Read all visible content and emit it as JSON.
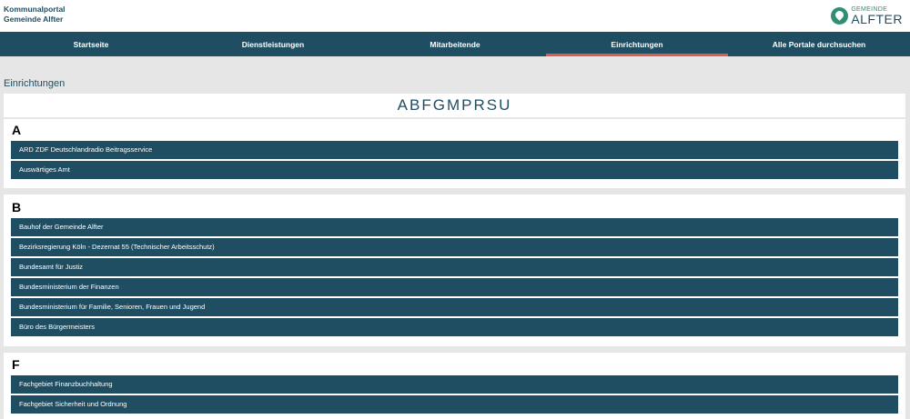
{
  "header": {
    "portal_line1": "Kommunalportal",
    "portal_line2": "Gemeinde Alfter",
    "logo_small": "GEMEINDE",
    "logo_big": "ALFTER"
  },
  "nav": {
    "items": [
      {
        "label": "Startseite"
      },
      {
        "label": "Dienstleistungen"
      },
      {
        "label": "Mitarbeitende"
      },
      {
        "label": "Einrichtungen"
      },
      {
        "label": "Alle Portale durchsuchen"
      }
    ],
    "active_index": 3
  },
  "breadcrumb": "Einrichtungen",
  "alphabet": [
    "A",
    "B",
    "F",
    "G",
    "M",
    "P",
    "R",
    "S",
    "U"
  ],
  "sections": [
    {
      "letter": "A",
      "entries": [
        "ARD ZDF Deutschlandradio Beitragsservice",
        "Auswärtiges Amt"
      ]
    },
    {
      "letter": "B",
      "entries": [
        "Bauhof der Gemeinde Alfter",
        "Bezirksregierung Köln - Dezernat 55 (Technischer Arbeitsschutz)",
        "Bundesamt für Justiz",
        "Bundesministerium der Finanzen",
        "Bundesministerium für Familie, Senioren, Frauen und Jugend",
        "Büro des Bürgermeisters"
      ]
    },
    {
      "letter": "F",
      "entries": [
        "Fachgebiet Finanzbuchhaltung",
        "Fachgebiet Sicherheit und Ordnung"
      ]
    }
  ],
  "colors": {
    "primary": "#1f4e63",
    "active_underline": "#e05a4e",
    "logo_green": "#2f8f74",
    "page_background": "#e6e6e6"
  }
}
